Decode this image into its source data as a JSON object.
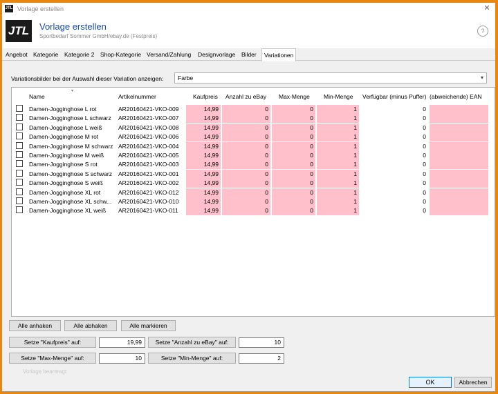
{
  "window": {
    "title": "Vorlage erstellen",
    "close": "✕",
    "app_icon": "JTL"
  },
  "header": {
    "logo": "JTL",
    "title": "Vorlage erstellen",
    "subtitle": "Sportbedarf Sommer GmbH/ebay.de (Festpreis)",
    "help_icon": "?"
  },
  "tabs": [
    "Angebot",
    "Kategorie",
    "Kategorie 2",
    "Shop-Kategorie",
    "Versand/Zahlung",
    "Designvorlage",
    "Bilder",
    "Variationen"
  ],
  "active_tab": "Variationen",
  "variation_images": {
    "label": "Variationsbilder bei der Auswahl dieser Variation anzeigen:",
    "selected": "Farbe"
  },
  "grid": {
    "columns": [
      "Name",
      "Artikelnummer",
      "Kaufpreis",
      "Anzahl zu eBay",
      "Max-Menge",
      "Min-Menge",
      "Verfügbar (minus Puffer)",
      "(abweichende) EAN"
    ],
    "rows": [
      {
        "name": "Damen-Jogginghose L rot",
        "sku": "AR20160421-VKO-009",
        "price": "14,99",
        "qty_ebay": "0",
        "max": "0",
        "min": "1",
        "avail": "0",
        "ean": ""
      },
      {
        "name": "Damen-Jogginghose L schwarz",
        "sku": "AR20160421-VKO-007",
        "price": "14,99",
        "qty_ebay": "0",
        "max": "0",
        "min": "1",
        "avail": "0",
        "ean": ""
      },
      {
        "name": "Damen-Jogginghose L weiß",
        "sku": "AR20160421-VKO-008",
        "price": "14,99",
        "qty_ebay": "0",
        "max": "0",
        "min": "1",
        "avail": "0",
        "ean": ""
      },
      {
        "name": "Damen-Jogginghose M rot",
        "sku": "AR20160421-VKO-006",
        "price": "14,99",
        "qty_ebay": "0",
        "max": "0",
        "min": "1",
        "avail": "0",
        "ean": ""
      },
      {
        "name": "Damen-Jogginghose M schwarz",
        "sku": "AR20160421-VKO-004",
        "price": "14,99",
        "qty_ebay": "0",
        "max": "0",
        "min": "1",
        "avail": "0",
        "ean": ""
      },
      {
        "name": "Damen-Jogginghose M weiß",
        "sku": "AR20160421-VKO-005",
        "price": "14,99",
        "qty_ebay": "0",
        "max": "0",
        "min": "1",
        "avail": "0",
        "ean": ""
      },
      {
        "name": "Damen-Jogginghose S rot",
        "sku": "AR20160421-VKO-003",
        "price": "14,99",
        "qty_ebay": "0",
        "max": "0",
        "min": "1",
        "avail": "0",
        "ean": ""
      },
      {
        "name": "Damen-Jogginghose S schwarz",
        "sku": "AR20160421-VKO-001",
        "price": "14,99",
        "qty_ebay": "0",
        "max": "0",
        "min": "1",
        "avail": "0",
        "ean": ""
      },
      {
        "name": "Damen-Jogginghose S weiß",
        "sku": "AR20160421-VKO-002",
        "price": "14,99",
        "qty_ebay": "0",
        "max": "0",
        "min": "1",
        "avail": "0",
        "ean": ""
      },
      {
        "name": "Damen-Jogginghose XL rot",
        "sku": "AR20160421-VKO-012",
        "price": "14,99",
        "qty_ebay": "0",
        "max": "0",
        "min": "1",
        "avail": "0",
        "ean": ""
      },
      {
        "name": "Damen-Jogginghose XL schw...",
        "sku": "AR20160421-VKO-010",
        "price": "14,99",
        "qty_ebay": "0",
        "max": "0",
        "min": "1",
        "avail": "0",
        "ean": ""
      },
      {
        "name": "Damen-Jogginghose XL weiß",
        "sku": "AR20160421-VKO-011",
        "price": "14,99",
        "qty_ebay": "0",
        "max": "0",
        "min": "1",
        "avail": "0",
        "ean": ""
      }
    ]
  },
  "actions": {
    "check_all": "Alle anhaken",
    "uncheck_all": "Alle abhaken",
    "select_all": "Alle markieren",
    "set_price_label": "Setze \"Kaufpreis\" auf:",
    "set_price_value": "19,99",
    "set_qty_label": "Setze \"Anzahl zu eBay\" auf:",
    "set_qty_value": "10",
    "set_max_label": "Setze \"Max-Menge\" auf:",
    "set_max_value": "10",
    "set_min_label": "Setze \"Min-Menge\" auf:",
    "set_min_value": "2"
  },
  "footer": {
    "faded_text": "Vorlage beantragt",
    "ok": "OK",
    "cancel": "Abbrechen"
  },
  "colors": {
    "accent": "#e8870f",
    "pink_cell": "#ffc0cb",
    "title_blue": "#1a4aa0"
  }
}
